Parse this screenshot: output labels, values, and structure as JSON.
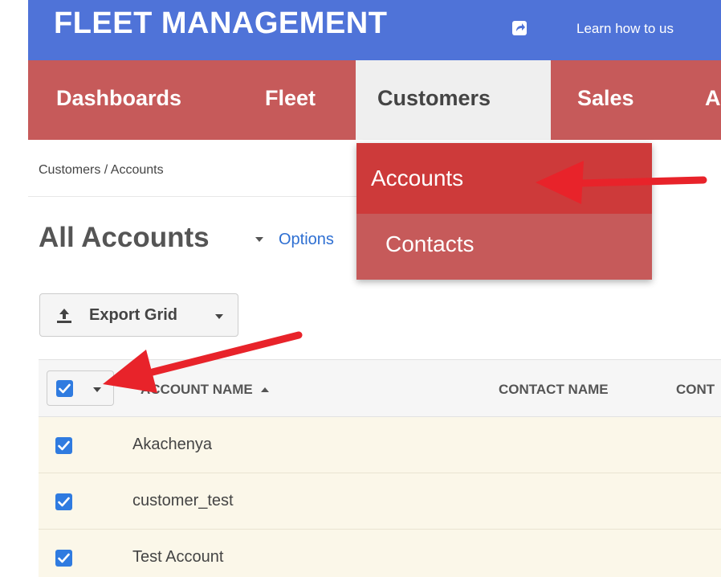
{
  "header": {
    "app_title": "FLEET MANAGEMENT",
    "learn_link": "Learn how to us"
  },
  "nav": {
    "items": [
      {
        "label": "Dashboards"
      },
      {
        "label": "Fleet"
      },
      {
        "label": "Customers"
      },
      {
        "label": "Sales"
      },
      {
        "label": "A"
      }
    ],
    "active": "Customers"
  },
  "dropdown": {
    "items": [
      {
        "label": "Accounts",
        "active": true
      },
      {
        "label": "Contacts",
        "active": false
      }
    ]
  },
  "breadcrumb": "Customers / Accounts",
  "page": {
    "title": "All Accounts",
    "options_link": "Options"
  },
  "toolbar": {
    "export_label": "Export Grid"
  },
  "grid": {
    "columns": [
      "ACCOUNT NAME",
      "CONTACT NAME",
      "CONT"
    ],
    "sort_column": "ACCOUNT NAME",
    "sort_direction": "ascending",
    "select_all_checked": true,
    "rows": [
      {
        "account_name": "Akachenya",
        "checked": true
      },
      {
        "account_name": "customer_test",
        "checked": true
      },
      {
        "account_name": "Test Account",
        "checked": true
      }
    ]
  },
  "colors": {
    "topbar": "#4f73d8",
    "navbar": "#c65a5a",
    "dropdown_active": "#cd3a3a",
    "checkbox": "#2f7be0",
    "annotation_arrow": "#e8232a"
  },
  "icons": {
    "external": "external-link-icon",
    "export": "upload-icon",
    "check": "checkmark-icon"
  }
}
